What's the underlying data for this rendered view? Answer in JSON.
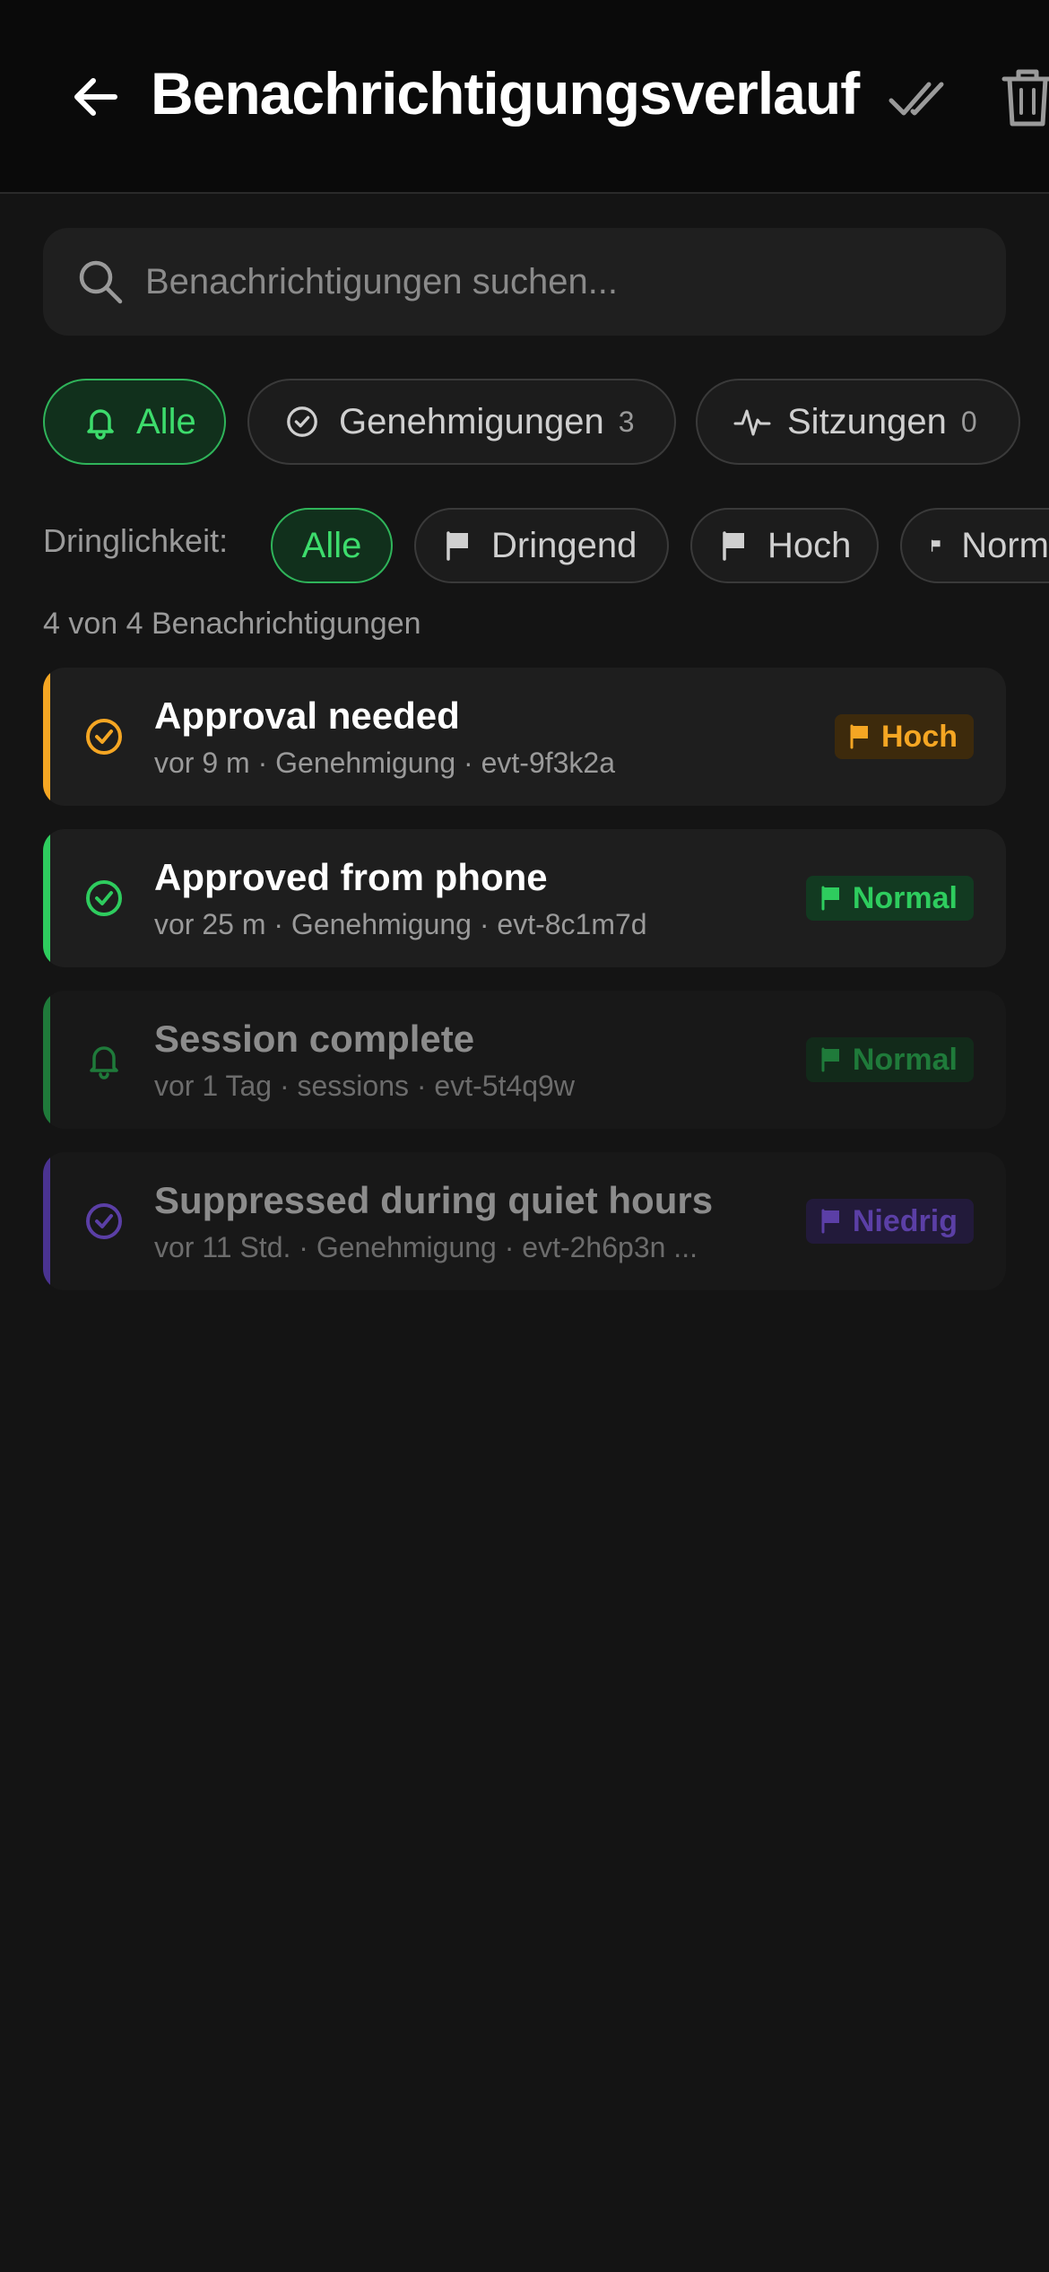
{
  "header": {
    "title": "Benachrichtigungsverlauf",
    "back_icon": "arrow-left-icon",
    "mark_all_icon": "double-check-icon",
    "delete_icon": "trash-icon"
  },
  "search": {
    "placeholder": "Benachrichtigungen suchen...",
    "value": ""
  },
  "category_filters": [
    {
      "label": "Alle",
      "icon": "bell-icon",
      "count": null,
      "active": true
    },
    {
      "label": "Genehmigungen",
      "icon": "check-circle-icon",
      "count": "3",
      "active": false
    },
    {
      "label": "Sitzungen",
      "icon": "activity-icon",
      "count": "0",
      "active": false
    }
  ],
  "urgency": {
    "label": "Dringlichkeit:",
    "options": [
      {
        "label": "Alle",
        "active": true
      },
      {
        "label": "Dringend",
        "icon": "flag-icon",
        "active": false
      },
      {
        "label": "Hoch",
        "icon": "flag-icon",
        "active": false
      },
      {
        "label": "Norm",
        "icon": "flag-icon",
        "active": false
      }
    ]
  },
  "result_count": "4 von 4 Benachrichtigungen",
  "colors": {
    "accent_green": "#3ddc6c",
    "orange": "#f5a623",
    "green": "#2ecc5e",
    "dark_green": "#1f7a3a",
    "purple": "#5b3fa6"
  },
  "notifications": [
    {
      "title": "Approval needed",
      "meta": "vor 9 m · Genehmigung · evt-9f3k2a",
      "icon": "check-circle-icon",
      "priority": "Hoch",
      "read": false
    },
    {
      "title": "Approved from phone",
      "meta": "vor 25 m · Genehmigung · evt-8c1m7d",
      "icon": "check-circle-icon",
      "priority": "Normal",
      "read": false
    },
    {
      "title": "Session complete",
      "meta": "vor 1 Tag · sessions · evt-5t4q9w",
      "icon": "bell-icon",
      "priority": "Normal",
      "read": true
    },
    {
      "title": "Suppressed during quiet hours",
      "meta": "vor 11 Std. · Genehmigung · evt-2h6p3n ...",
      "icon": "check-circle-icon",
      "priority": "Niedrig",
      "read": true
    }
  ]
}
